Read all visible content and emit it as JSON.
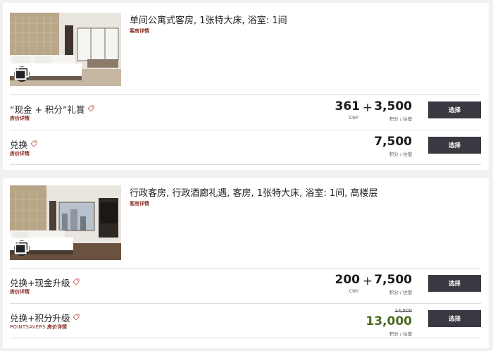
{
  "rooms": [
    {
      "title": "单间公寓式客房, 1张特大床, 浴室: 1间",
      "details_link": "客房详情",
      "rates": [
        {
          "name": "“现金 + 积分”礼賞",
          "link": "房价详情",
          "cash": "361",
          "cash_unit": "CNY",
          "points": "3,500",
          "points_unit": "积分 / 住宿",
          "button": "选择"
        },
        {
          "name": "兑换",
          "link": "房价详情",
          "points": "7,500",
          "points_unit": "积分 / 住宿",
          "button": "选择"
        }
      ]
    },
    {
      "title": "行政客房, 行政酒廊礼遇, 客房, 1张特大床, 浴室: 1间, 高楼层",
      "details_link": "客房详情",
      "rates": [
        {
          "name": "兑换+现金升级",
          "link": "房价详情",
          "cash": "200",
          "cash_unit": "CNY",
          "points": "7,500",
          "points_unit": "积分 / 住宿",
          "button": "选择"
        },
        {
          "name": "兑换+积分升级",
          "link_prefix": "POINTSAVERS",
          "link": "房价详情",
          "original_points": "14,500",
          "points": "13,000",
          "points_unit": "积分 / 住宿",
          "button": "选择"
        }
      ]
    }
  ],
  "colors": {
    "accent_link": "#8a2a24",
    "button_bg": "#3a3942",
    "pointsavers_green": "#4d6a22"
  },
  "icons": {
    "gallery": "gallery-icon",
    "rate_tag": "tag-icon"
  }
}
